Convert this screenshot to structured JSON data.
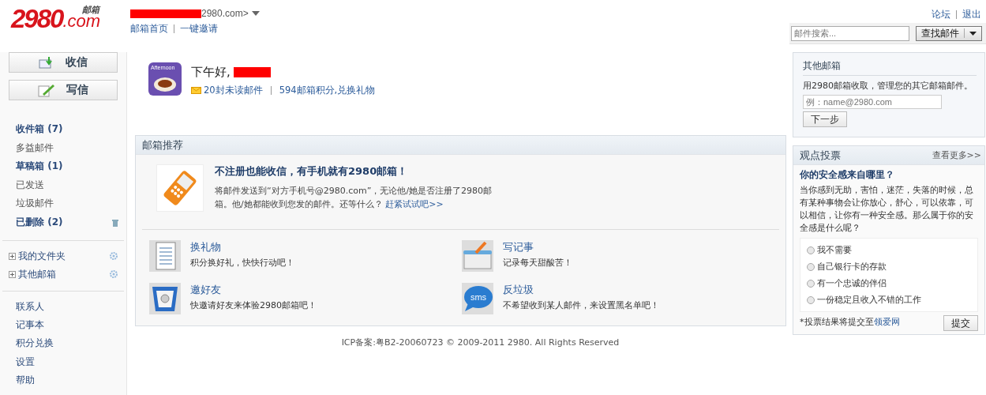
{
  "header": {
    "logo_number": "2980",
    "logo_domain": ".com",
    "logo_tag": "邮箱",
    "account": "2980.com>",
    "links": [
      "邮箱首页",
      "一键邀请"
    ],
    "top_links": [
      "论坛",
      "退出"
    ],
    "search": {
      "placeholder": "邮件搜索...",
      "button": "查找邮件"
    }
  },
  "sidebar": {
    "buttons": [
      {
        "kind": "receive",
        "label": "收信"
      },
      {
        "kind": "compose",
        "label": "写信"
      }
    ],
    "folders": [
      {
        "label": "收件箱 (7)",
        "unread": true,
        "kind": "plain"
      },
      {
        "label": "多益邮件",
        "unread": false,
        "kind": "plain"
      },
      {
        "label": "草稿箱 (1)",
        "unread": true,
        "kind": "plain"
      },
      {
        "label": "已发送",
        "unread": false,
        "kind": "plain"
      },
      {
        "label": "垃圾邮件",
        "unread": false,
        "kind": "plain"
      },
      {
        "label": "已删除 (2)",
        "unread": true,
        "kind": "trash"
      }
    ],
    "groups": [
      {
        "label": "我的文件夹",
        "expanded": false
      },
      {
        "label": "其他邮箱",
        "expanded": false
      }
    ],
    "tools": [
      "联系人",
      "记事本",
      "积分兑换",
      "设置",
      "帮助"
    ]
  },
  "welcome": {
    "greeting": "下午好,",
    "avatar_caption": "Afternoon",
    "unread": "20封未读邮件",
    "points": "594邮箱积分,兑换礼物"
  },
  "recommend": {
    "title": "邮箱推荐",
    "headline": "不注册也能收信，有手机就有2980邮箱！",
    "text": "将邮件发送到“对方手机号@2980.com”，无论他/她是否注册了2980邮箱。他/她都能收到您发的邮件。还等什么？",
    "link": "赶紧试试吧>>",
    "features": [
      {
        "kind": "list",
        "title": "换礼物",
        "text": "积分换好礼，快快行动吧！"
      },
      {
        "kind": "note",
        "title": "写记事",
        "text": "记录每天甜酸苦！"
      },
      {
        "kind": "invite",
        "title": "邀好友",
        "text": "快邀请好友来体验2980邮箱吧！"
      },
      {
        "kind": "sms",
        "title": "反垃圾",
        "text": "不希望收到某人邮件，来设置黑名单吧！",
        "icon_text": "sms"
      }
    ]
  },
  "other_mail": {
    "title": "其他邮箱",
    "text": "用2980邮箱收取，管理您的其它邮箱邮件。",
    "placeholder": "例：name@2980.com",
    "button": "下一步"
  },
  "poll": {
    "title": "观点投票",
    "more": "查看更多>>",
    "question": "你的安全感来自哪里？",
    "text": "当你感到无助，害怕，迷茫，失落的时候，总有某种事物会让你放心，舒心，可以依靠，可以相信，让你有一种安全感。那么属于你的安全感是什么呢？",
    "options": [
      {
        "label": "我不需要",
        "selected": false
      },
      {
        "label": "自己银行卡的存款",
        "selected": false
      },
      {
        "label": "有一个忠诚的伴侣",
        "selected": false
      },
      {
        "label": "一份稳定且收入不错的工作",
        "selected": false
      }
    ],
    "note": "*投票结果将提交至",
    "note_link": "领爱网",
    "submit": "提交"
  },
  "footer": "ICP备案:粤B2-20060723 © 2009-2011 2980. All Rights Reserved"
}
